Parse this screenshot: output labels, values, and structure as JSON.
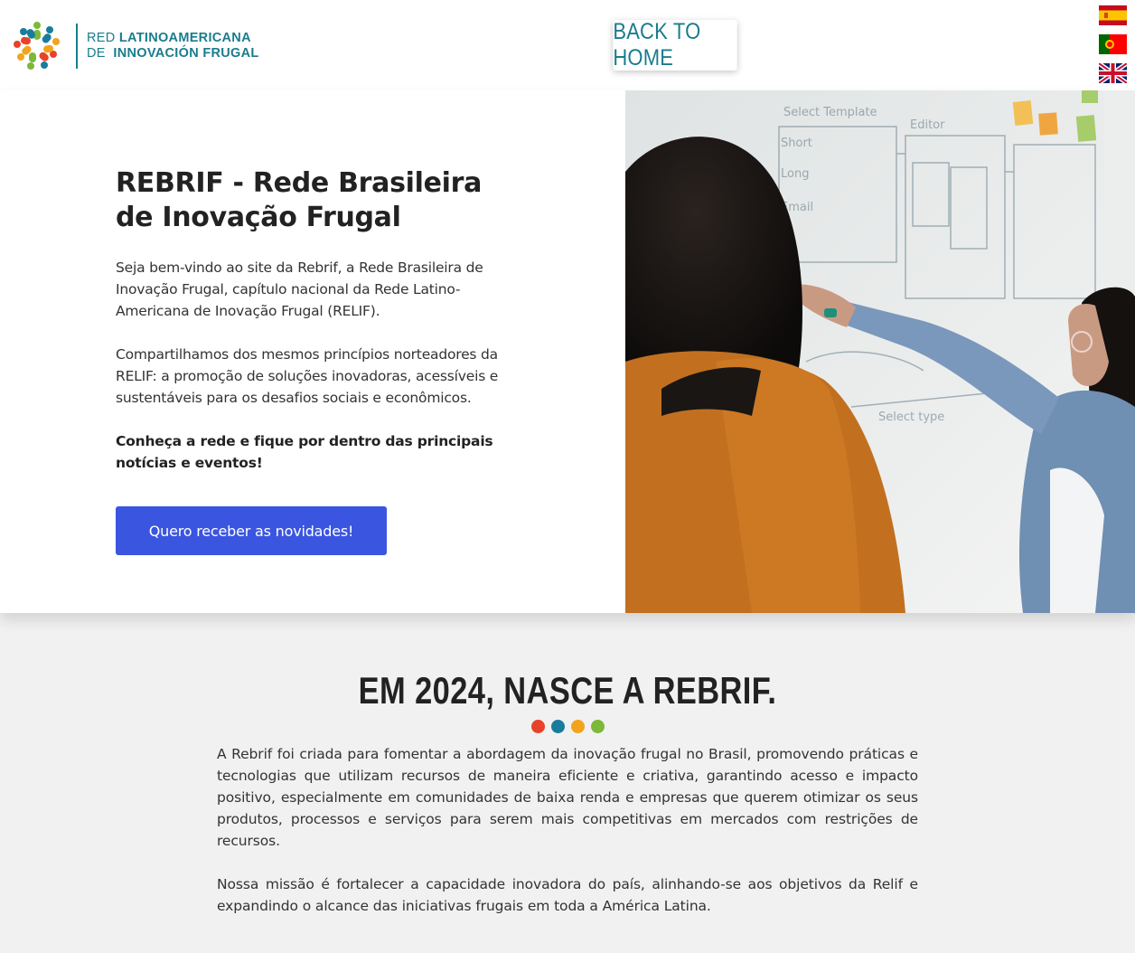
{
  "header": {
    "logo": {
      "line1_prefix": "RED",
      "line1_main": "LATINOAMERICANA",
      "line2_prefix": "DE",
      "line2_main": "INNOVACIÓN FRUGAL"
    },
    "back_home_label": "BACK TO HOME",
    "languages": [
      {
        "name": "spanish-flag-icon"
      },
      {
        "name": "portuguese-flag-icon"
      },
      {
        "name": "uk-flag-icon"
      }
    ]
  },
  "hero": {
    "title": "REBRIF - Rede Brasileira de Inovação Frugal",
    "p1": "Seja bem-vindo ao site da Rebrif, a Rede Brasileira de Inovação Frugal, capítulo nacional da Rede Latino-Americana de Inovação Frugal (RELIF).",
    "p2": "Compartilhamos dos mesmos princípios norteadores da RELIF: a promoção de soluções inovadoras, acessíveis e sustentáveis para os desafios sociais e econômicos.",
    "p3": "Conheça a rede e fique por dentro das principais notícias e eventos!",
    "cta_label": "Quero receber as novidades!"
  },
  "section": {
    "title": "EM 2024, NASCE A REBRIF.",
    "dots": [
      "#e8432a",
      "#1a7c9c",
      "#f2a41c",
      "#7cb83a"
    ],
    "p1": "A Rebrif foi criada para fomentar a abordagem da inovação frugal no Brasil, promovendo práticas e tecnologias que utilizam recursos de maneira eficiente e criativa, garantindo acesso e impacto positivo, especialmente em comunidades de baixa renda e empresas que querem otimizar os seus produtos, processos e serviços para serem mais competitivas em mercados com restrições de recursos.",
    "p2": "Nossa missão é fortalecer a capacidade inovadora do país, alinhando-se aos objetivos da Relif e expandindo o alcance das iniciativas frugais em toda a América Latina."
  },
  "colors": {
    "brand_teal": "#1a7c8c",
    "cta_blue": "#3a55e0"
  }
}
